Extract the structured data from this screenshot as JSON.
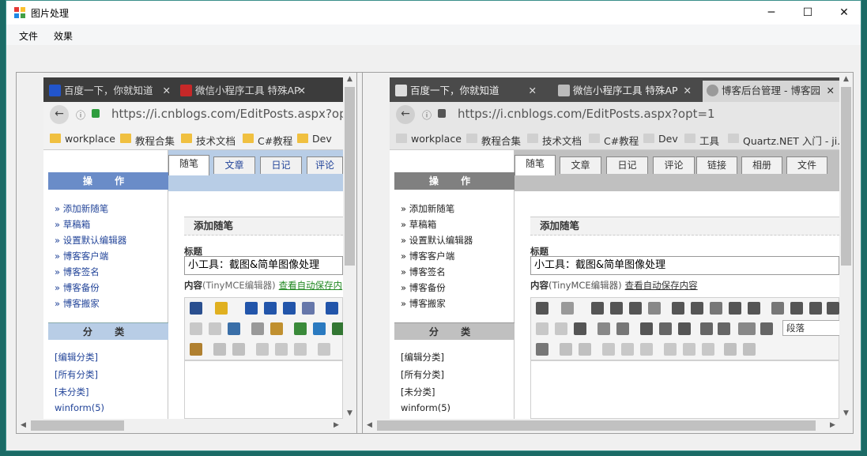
{
  "window": {
    "title": "图片处理",
    "minimize": "─",
    "maximize": "☐",
    "close": "✕"
  },
  "menu": [
    {
      "label": "文件"
    },
    {
      "label": "效果"
    }
  ],
  "left": {
    "tabs": [
      {
        "title": "百度一下，你就知道"
      },
      {
        "title": "微信小程序工具 特殊AP"
      }
    ],
    "url": "https://i.cnblogs.com/EditPosts.aspx?opt=1",
    "bookmarks": [
      "workplace",
      "教程合集",
      "技术文档",
      "C#教程",
      "Dev"
    ],
    "page_tabs": [
      "随笔",
      "文章",
      "日记",
      "评论"
    ],
    "content_label_link": "查看自动保存内"
  },
  "right": {
    "tabs": [
      {
        "title": "百度一下，你就知道"
      },
      {
        "title": "微信小程序工具 特殊AP"
      },
      {
        "title": "博客后台管理 - 博客园"
      }
    ],
    "url": "https://i.cnblogs.com/EditPosts.aspx?opt=1",
    "bookmarks": [
      "workplace",
      "教程合集",
      "技术文档",
      "C#教程",
      "Dev",
      "工具",
      "Quartz.NET 入门 - ji..."
    ],
    "page_tabs": [
      "随笔",
      "文章",
      "日记",
      "评论",
      "链接",
      "相册",
      "文件"
    ],
    "content_label_link": "查看自动保存内容",
    "paragraph_select": "段落"
  },
  "common": {
    "side_ops_header": "操 作",
    "ops": [
      "» 添加新随笔",
      "» 草稿箱",
      "» 设置默认编辑器",
      "» 博客客户端",
      "» 博客签名",
      "» 博客备份",
      "» 博客搬家"
    ],
    "side_cat_header": "分 类",
    "cats": [
      "[编辑分类]",
      "[所有分类]",
      "[未分类]",
      "winform(5)"
    ],
    "section_title": "添加随笔",
    "title_label": "标题",
    "title_value": "小工具：截图&简单图像处理",
    "content_label": "内容",
    "content_label_sub": "(TinyMCE编辑器)"
  },
  "colors": {
    "left_side_header": "#6a8cc8",
    "right_side_header": "#808080",
    "left_tab_strip": "#b8cde6",
    "right_tab_strip": "#c0c0c0"
  }
}
